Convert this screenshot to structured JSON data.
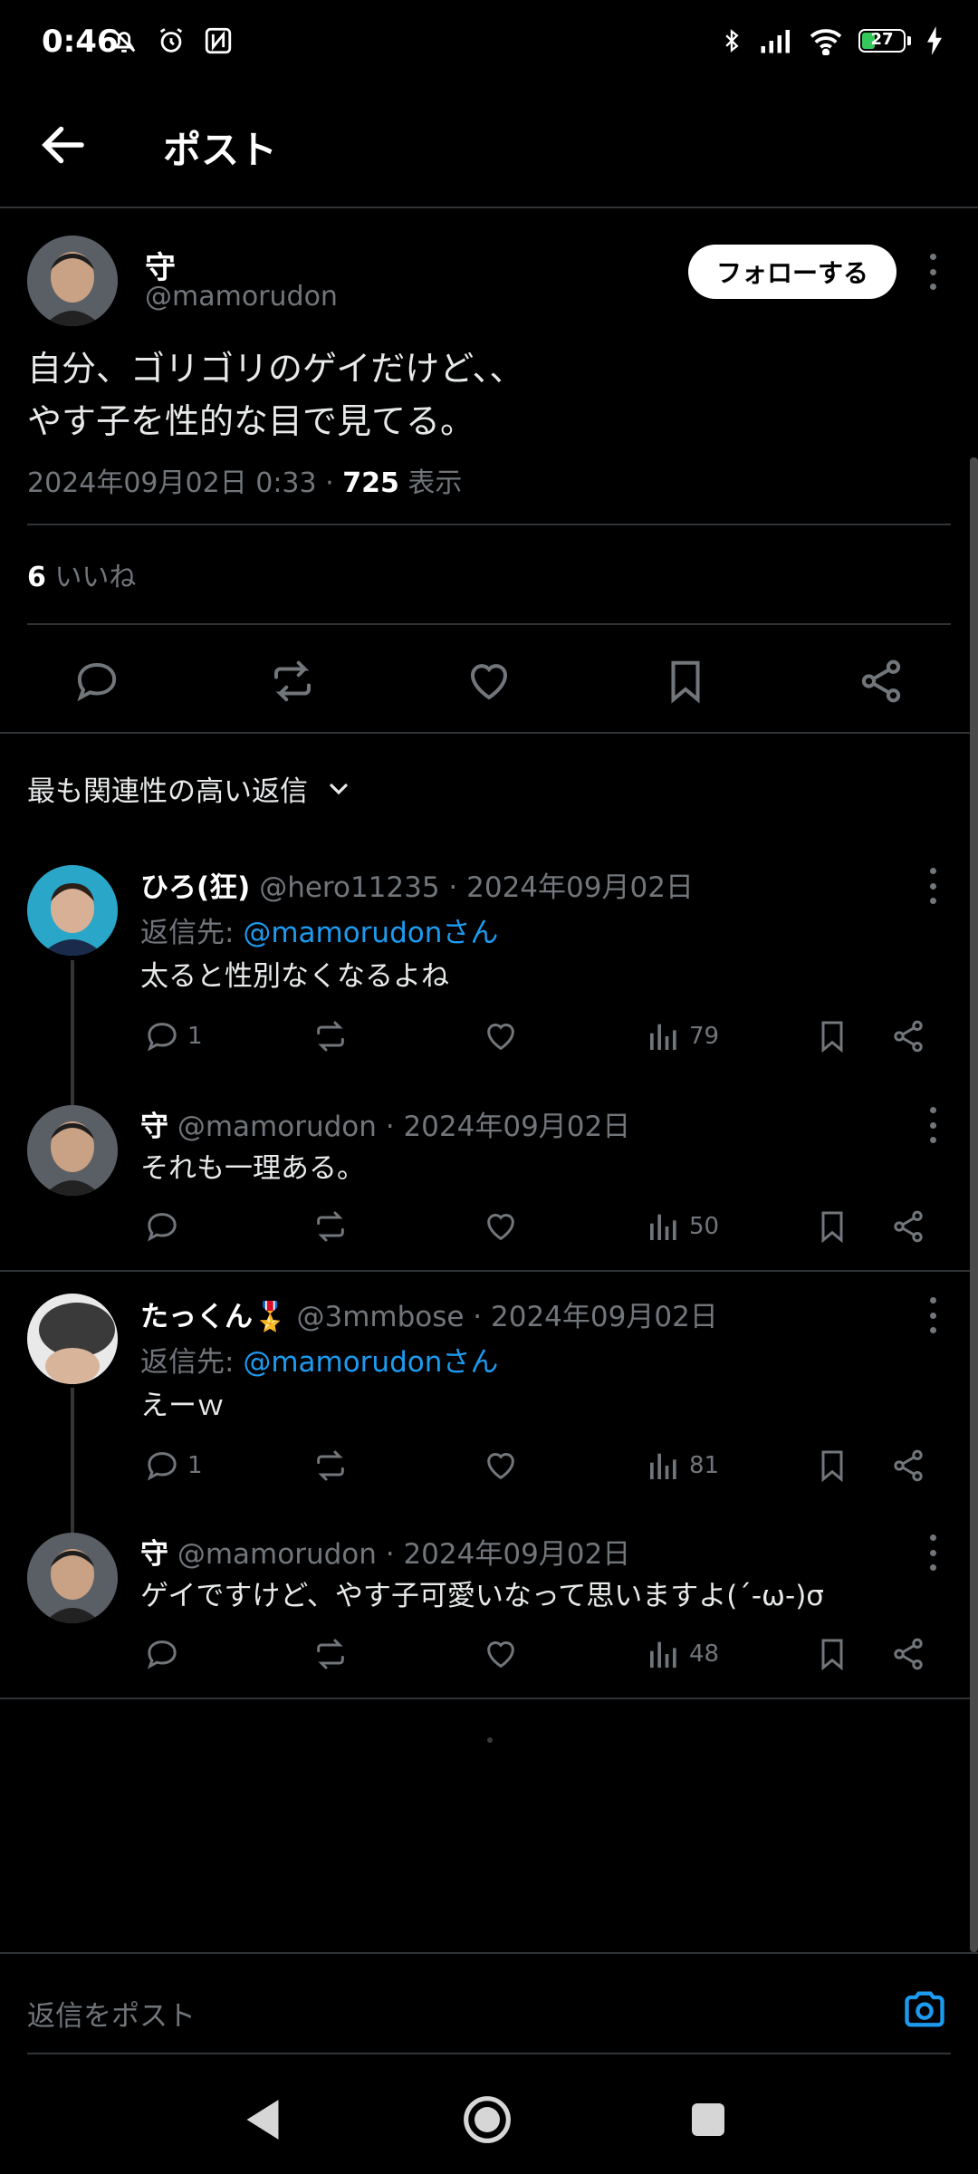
{
  "status_bar": {
    "time": "0:46",
    "battery": "27"
  },
  "header": {
    "title": "ポスト"
  },
  "post": {
    "author_name": "守",
    "author_handle": "@mamorudon",
    "follow_label": "フォローする",
    "text": "自分、ゴリゴリのゲイだけど、、\nやす子を性的な目で見てる。",
    "timestamp": "2024年09月02日 0:33 · ",
    "views_count": "725",
    "views_label": " 表示",
    "likes_count": "6",
    "likes_label": " いいね"
  },
  "sort": {
    "label": "最も関連性の高い返信"
  },
  "replies": [
    {
      "name": "ひろ(狂)",
      "handle": "@hero11235 · 2024年09月02日",
      "reply_to_prefix": "返信先: ",
      "reply_to_target": "@mamorudonさん",
      "text": "太ると性別なくなるよね",
      "reply_count": "1",
      "views": "79"
    },
    {
      "name": "守",
      "handle": "@mamorudon · 2024年09月02日",
      "text": "それも一理ある。",
      "reply_count": "",
      "views": "50"
    },
    {
      "name": "たっくん🎖️",
      "handle": "@3mmbose · 2024年09月02日",
      "reply_to_prefix": "返信先: ",
      "reply_to_target": "@mamorudonさん",
      "text": "えーｗ",
      "reply_count": "1",
      "views": "81"
    },
    {
      "name": "守",
      "handle": "@mamorudon · 2024年09月02日",
      "text": "ゲイですけど、やす子可愛いなって思いますよ(´-ω-)σ",
      "reply_count": "",
      "views": "48"
    }
  ],
  "compose": {
    "placeholder": "返信をポスト"
  },
  "colors": {
    "accent": "#1d9bf0",
    "background": "#000000",
    "muted": "#71767b",
    "battery": "#35c759"
  }
}
